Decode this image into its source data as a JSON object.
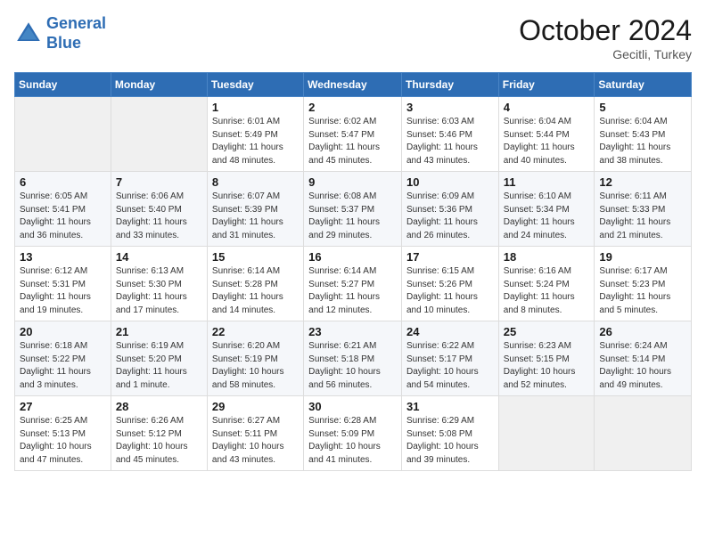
{
  "header": {
    "logo_line1": "General",
    "logo_line2": "Blue",
    "month_title": "October 2024",
    "location": "Gecitli, Turkey"
  },
  "columns": [
    "Sunday",
    "Monday",
    "Tuesday",
    "Wednesday",
    "Thursday",
    "Friday",
    "Saturday"
  ],
  "weeks": [
    [
      {
        "day": "",
        "info": ""
      },
      {
        "day": "",
        "info": ""
      },
      {
        "day": "1",
        "info": "Sunrise: 6:01 AM\nSunset: 5:49 PM\nDaylight: 11 hours and 48 minutes."
      },
      {
        "day": "2",
        "info": "Sunrise: 6:02 AM\nSunset: 5:47 PM\nDaylight: 11 hours and 45 minutes."
      },
      {
        "day": "3",
        "info": "Sunrise: 6:03 AM\nSunset: 5:46 PM\nDaylight: 11 hours and 43 minutes."
      },
      {
        "day": "4",
        "info": "Sunrise: 6:04 AM\nSunset: 5:44 PM\nDaylight: 11 hours and 40 minutes."
      },
      {
        "day": "5",
        "info": "Sunrise: 6:04 AM\nSunset: 5:43 PM\nDaylight: 11 hours and 38 minutes."
      }
    ],
    [
      {
        "day": "6",
        "info": "Sunrise: 6:05 AM\nSunset: 5:41 PM\nDaylight: 11 hours and 36 minutes."
      },
      {
        "day": "7",
        "info": "Sunrise: 6:06 AM\nSunset: 5:40 PM\nDaylight: 11 hours and 33 minutes."
      },
      {
        "day": "8",
        "info": "Sunrise: 6:07 AM\nSunset: 5:39 PM\nDaylight: 11 hours and 31 minutes."
      },
      {
        "day": "9",
        "info": "Sunrise: 6:08 AM\nSunset: 5:37 PM\nDaylight: 11 hours and 29 minutes."
      },
      {
        "day": "10",
        "info": "Sunrise: 6:09 AM\nSunset: 5:36 PM\nDaylight: 11 hours and 26 minutes."
      },
      {
        "day": "11",
        "info": "Sunrise: 6:10 AM\nSunset: 5:34 PM\nDaylight: 11 hours and 24 minutes."
      },
      {
        "day": "12",
        "info": "Sunrise: 6:11 AM\nSunset: 5:33 PM\nDaylight: 11 hours and 21 minutes."
      }
    ],
    [
      {
        "day": "13",
        "info": "Sunrise: 6:12 AM\nSunset: 5:31 PM\nDaylight: 11 hours and 19 minutes."
      },
      {
        "day": "14",
        "info": "Sunrise: 6:13 AM\nSunset: 5:30 PM\nDaylight: 11 hours and 17 minutes."
      },
      {
        "day": "15",
        "info": "Sunrise: 6:14 AM\nSunset: 5:28 PM\nDaylight: 11 hours and 14 minutes."
      },
      {
        "day": "16",
        "info": "Sunrise: 6:14 AM\nSunset: 5:27 PM\nDaylight: 11 hours and 12 minutes."
      },
      {
        "day": "17",
        "info": "Sunrise: 6:15 AM\nSunset: 5:26 PM\nDaylight: 11 hours and 10 minutes."
      },
      {
        "day": "18",
        "info": "Sunrise: 6:16 AM\nSunset: 5:24 PM\nDaylight: 11 hours and 8 minutes."
      },
      {
        "day": "19",
        "info": "Sunrise: 6:17 AM\nSunset: 5:23 PM\nDaylight: 11 hours and 5 minutes."
      }
    ],
    [
      {
        "day": "20",
        "info": "Sunrise: 6:18 AM\nSunset: 5:22 PM\nDaylight: 11 hours and 3 minutes."
      },
      {
        "day": "21",
        "info": "Sunrise: 6:19 AM\nSunset: 5:20 PM\nDaylight: 11 hours and 1 minute."
      },
      {
        "day": "22",
        "info": "Sunrise: 6:20 AM\nSunset: 5:19 PM\nDaylight: 10 hours and 58 minutes."
      },
      {
        "day": "23",
        "info": "Sunrise: 6:21 AM\nSunset: 5:18 PM\nDaylight: 10 hours and 56 minutes."
      },
      {
        "day": "24",
        "info": "Sunrise: 6:22 AM\nSunset: 5:17 PM\nDaylight: 10 hours and 54 minutes."
      },
      {
        "day": "25",
        "info": "Sunrise: 6:23 AM\nSunset: 5:15 PM\nDaylight: 10 hours and 52 minutes."
      },
      {
        "day": "26",
        "info": "Sunrise: 6:24 AM\nSunset: 5:14 PM\nDaylight: 10 hours and 49 minutes."
      }
    ],
    [
      {
        "day": "27",
        "info": "Sunrise: 6:25 AM\nSunset: 5:13 PM\nDaylight: 10 hours and 47 minutes."
      },
      {
        "day": "28",
        "info": "Sunrise: 6:26 AM\nSunset: 5:12 PM\nDaylight: 10 hours and 45 minutes."
      },
      {
        "day": "29",
        "info": "Sunrise: 6:27 AM\nSunset: 5:11 PM\nDaylight: 10 hours and 43 minutes."
      },
      {
        "day": "30",
        "info": "Sunrise: 6:28 AM\nSunset: 5:09 PM\nDaylight: 10 hours and 41 minutes."
      },
      {
        "day": "31",
        "info": "Sunrise: 6:29 AM\nSunset: 5:08 PM\nDaylight: 10 hours and 39 minutes."
      },
      {
        "day": "",
        "info": ""
      },
      {
        "day": "",
        "info": ""
      }
    ]
  ]
}
